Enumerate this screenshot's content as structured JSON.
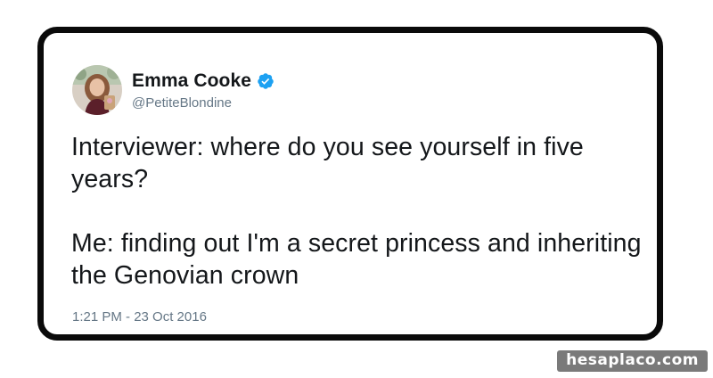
{
  "tweet": {
    "display_name": "Emma Cooke",
    "handle": "@PetiteBlondine",
    "verified": true,
    "text_paragraphs": [
      "Interviewer: where do you see yourself in five years?",
      "Me: finding out I'm a secret princess and inheriting the Genovian crown"
    ],
    "timestamp": "1:21 PM - 23 Oct 2016"
  },
  "watermark": {
    "text": "hesaplaco.com"
  },
  "colors": {
    "verified_badge": "#1da1f2",
    "text_primary": "#14171a",
    "text_secondary": "#657786",
    "card_border": "#0a0a0a"
  },
  "icons": {
    "verified": "verified-badge-icon"
  }
}
